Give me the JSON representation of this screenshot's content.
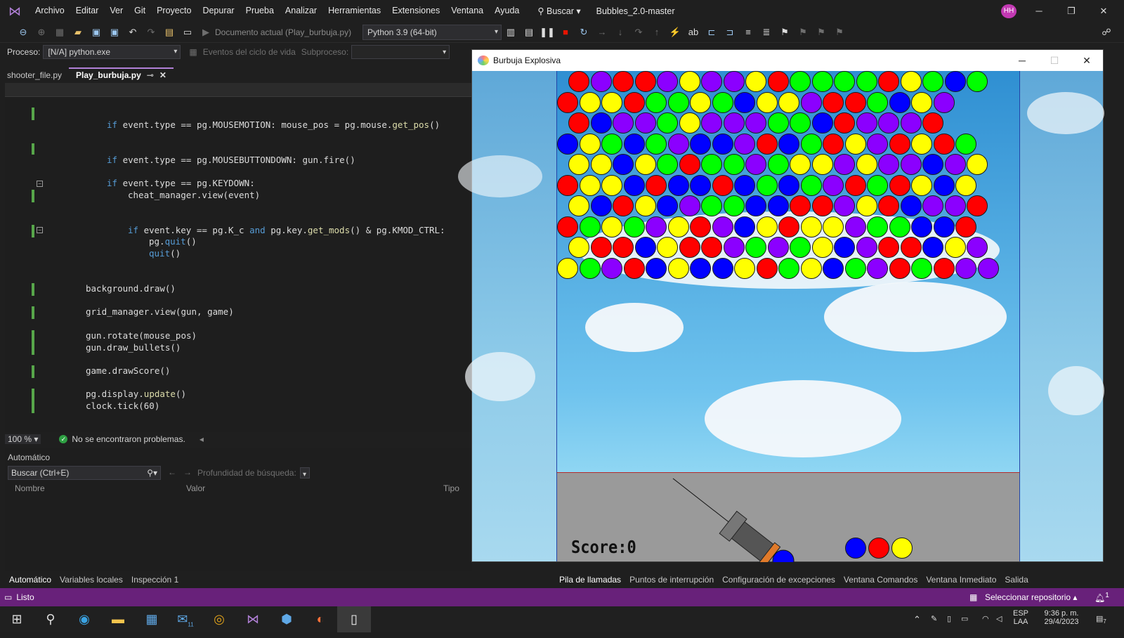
{
  "menubar": {
    "items": [
      "Archivo",
      "Editar",
      "Ver",
      "Git",
      "Proyecto",
      "Depurar",
      "Prueba",
      "Analizar",
      "Herramientas",
      "Extensiones",
      "Ventana",
      "Ayuda"
    ],
    "search": "Buscar",
    "solution": "Bubbles_2.0-master",
    "avatar": "HH"
  },
  "toolbar": {
    "start_label": "Documento actual (Play_burbuja.py)",
    "env": "Python 3.9 (64-bit)"
  },
  "procbar": {
    "process_label": "Proceso:",
    "process_value": "[N/A] python.exe",
    "events": "Eventos del ciclo de vida",
    "thread": "Subproceso:"
  },
  "tabs": [
    {
      "label": "shooter_file.py"
    },
    {
      "label": "Play_burbuja.py"
    }
  ],
  "code": {
    "l1a": "if",
    "l1b": " event.type == pg.MOUSEMOTION: mouse_pos = pg.mouse.",
    "l1c": "get_pos",
    "l1d": "()",
    "l2a": "if",
    "l2b": " event.type == pg.MOUSEBUTTONDOWN: gun.fire()",
    "l3a": "if",
    "l3b": " event.type == pg.KEYDOWN:",
    "l4": "cheat_manager.view(event)",
    "l5a": "if",
    "l5b": " event.key == pg.K_c ",
    "l5c": "and",
    "l5d": " pg.key.",
    "l5e": "get_mods",
    "l5f": "() & pg.KMOD_CTRL:",
    "l6a": "pg.",
    "l6b": "quit",
    "l6c": "()",
    "l7a": "quit",
    "l7b": "()",
    "l8": "background.draw()",
    "l9": "grid_manager.view(gun, game)",
    "l10": "gun.rotate(mouse_pos)",
    "l11": "gun.draw_bullets()",
    "l12": "game.drawScore()",
    "l13a": "pg.display.",
    "l13b": "update",
    "l13c": "()",
    "l14": "clock.tick(60)"
  },
  "editor_status": {
    "zoom": "100 %",
    "issues": "No se encontraron problemas."
  },
  "autos": {
    "title": "Automático",
    "search": "Buscar (Ctrl+E)",
    "depth": "Profundidad de búsqueda:",
    "col_name": "Nombre",
    "col_value": "Valor",
    "col_type": "Tipo"
  },
  "bottom_tabs_left": [
    "Automático",
    "Variables locales",
    "Inspección 1"
  ],
  "bottom_tabs_right": [
    "Pila de llamadas",
    "Puntos de interrupción",
    "Configuración de excepciones",
    "Ventana Comandos",
    "Ventana Inmediato",
    "Salida"
  ],
  "vs_status": {
    "ready": "Listo",
    "repo": "Seleccionar repositorio",
    "notif": "1"
  },
  "game": {
    "title": "Burbuja Explosiva",
    "score": "Score:0",
    "next_colors": [
      "#0000ff",
      "#ff0000",
      "#ffff00"
    ],
    "colors": {
      "R": "#ff0000",
      "Y": "#ffff00",
      "B": "#0000ff",
      "P": "#8b00ff",
      "G": "#00ff00"
    },
    "rows": [
      "RPRRPYPPYRGGGGRYGBG",
      "RYYRGGYGBYYPRRGBYP",
      "RBPPGYPPPGGBRPPPR",
      "BYGBGPBBPRBGRYPRYRG",
      "YYBYGRGGPGYYPYPPBPY",
      "RYYBRBBRBGBGPRGRYBY",
      "YBRYBPGGBBRRPYRBPPR",
      "RGYGPYRPBYRYYPGGBBR",
      "YRRBYRRPGPGYBPRRBYP",
      "YGPRBYBBYRGYBGPRGRPP"
    ]
  },
  "taskbar": {
    "lang1": "ESP",
    "lang2": "LAA",
    "time": "9:36 p. m.",
    "date": "29/4/2023",
    "badge": "7",
    "mail_badge": "11"
  }
}
